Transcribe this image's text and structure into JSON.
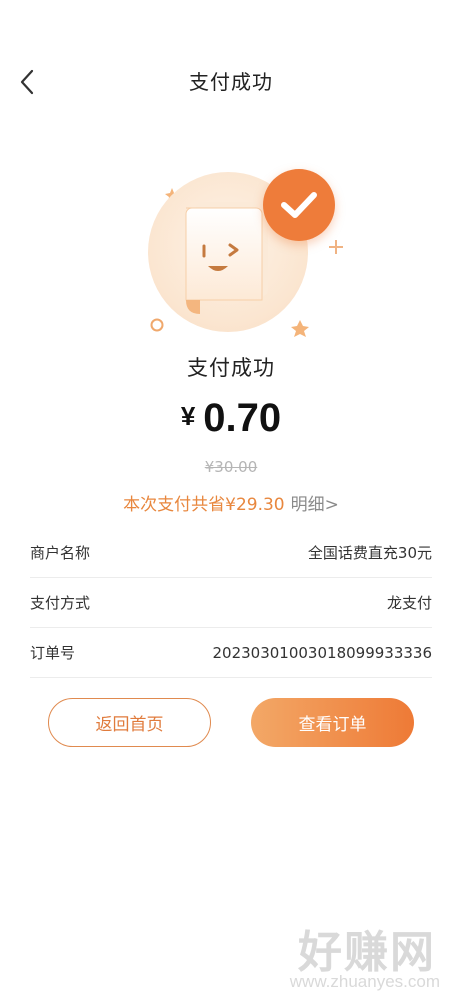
{
  "header": {
    "title": "支付成功",
    "back_icon": "chevron-left-icon"
  },
  "illustration": {
    "icon": "receipt-smiley-icon",
    "badge_icon": "checkmark-icon",
    "accent_color": "#ee7c3a"
  },
  "result": {
    "status": "支付成功",
    "currency": "¥",
    "amount": "0.70",
    "original_price": "¥30.00",
    "savings_text": "本次支付共省¥29.30",
    "detail_link": "明细>"
  },
  "info": [
    {
      "label": "商户名称",
      "value": "全国话费直充30元"
    },
    {
      "label": "支付方式",
      "value": "龙支付"
    },
    {
      "label": "订单号",
      "value": "20230301003018099933336"
    }
  ],
  "buttons": {
    "home": "返回首页",
    "view_order": "查看订单"
  },
  "watermark": {
    "logo_text": "好赚网",
    "url": "www.zhuanyes.com"
  }
}
